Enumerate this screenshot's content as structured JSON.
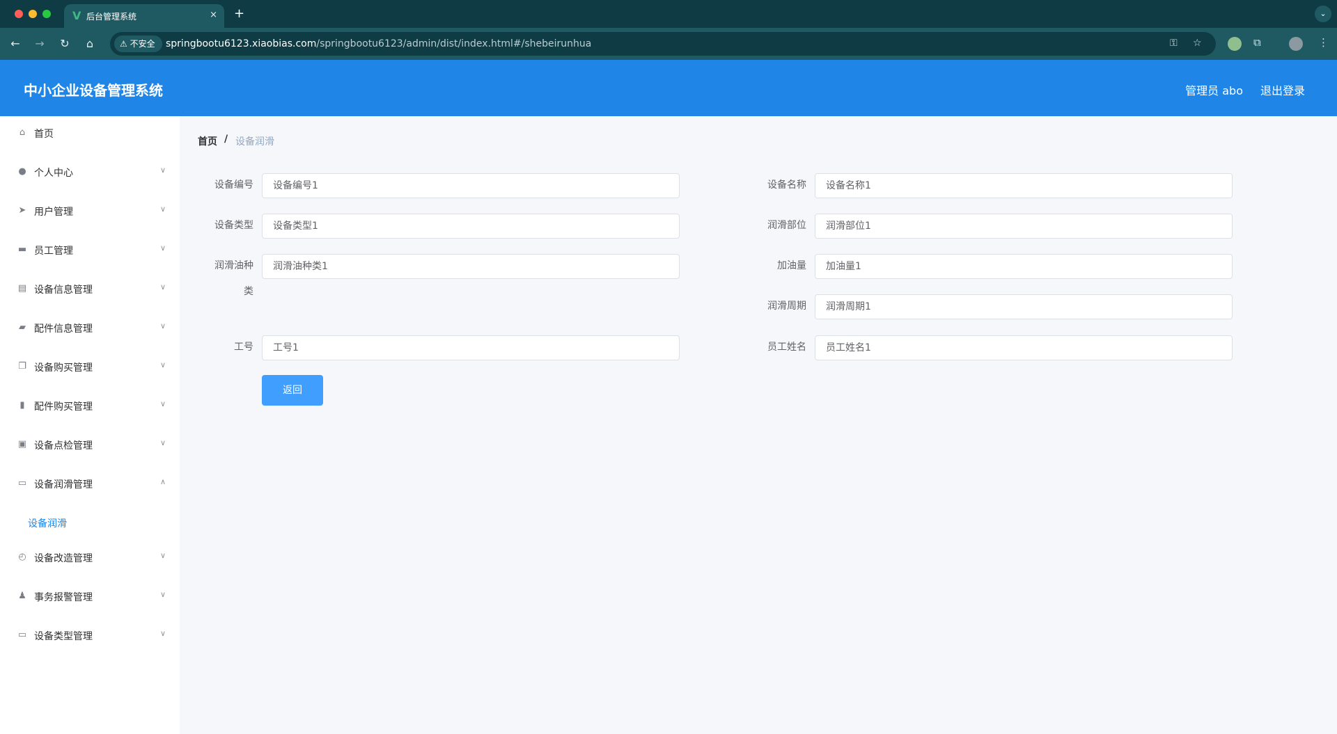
{
  "browser": {
    "tab_title": "后台管理系统",
    "tab_close": "×",
    "new_tab": "+",
    "insecure_label": "不安全",
    "url_host": "springbootu6123.xiaobias.com",
    "url_path": "/springbootu6123/admin/dist/index.html#/shebeirunhua"
  },
  "header": {
    "app_title": "中小企业设备管理系统",
    "user_label": "管理员 abo",
    "logout_label": "退出登录"
  },
  "sidebar": {
    "items": [
      {
        "label": "首页",
        "icon": "home-icon",
        "expanded": null
      },
      {
        "label": "个人中心",
        "icon": "user-icon",
        "expanded": false
      },
      {
        "label": "用户管理",
        "icon": "send-icon",
        "expanded": false
      },
      {
        "label": "员工管理",
        "icon": "monitor-icon",
        "expanded": false
      },
      {
        "label": "设备信息管理",
        "icon": "clipboard-icon",
        "expanded": false
      },
      {
        "label": "配件信息管理",
        "icon": "wallet-icon",
        "expanded": false
      },
      {
        "label": "设备购买管理",
        "icon": "copy-icon",
        "expanded": false
      },
      {
        "label": "配件购买管理",
        "icon": "bar-chart-icon",
        "expanded": false
      },
      {
        "label": "设备点检管理",
        "icon": "checklist-icon",
        "expanded": false
      },
      {
        "label": "设备润滑管理",
        "icon": "chat-icon",
        "expanded": true
      },
      {
        "label": "设备改造管理",
        "icon": "compass-icon",
        "expanded": false
      },
      {
        "label": "事务报警管理",
        "icon": "person-stamp-icon",
        "expanded": false
      },
      {
        "label": "设备类型管理",
        "icon": "id-card-icon",
        "expanded": false
      }
    ],
    "submenu_active": "设备润滑"
  },
  "breadcrumb": {
    "home": "首页",
    "separator": "/",
    "current": "设备润滑"
  },
  "form": {
    "fields": {
      "device_no": {
        "label": "设备编号",
        "value": "设备编号1"
      },
      "device_name": {
        "label": "设备名称",
        "value": "设备名称1"
      },
      "device_type": {
        "label": "设备类型",
        "value": "设备类型1"
      },
      "lube_part": {
        "label": "润滑部位",
        "value": "润滑部位1"
      },
      "oil_type": {
        "label_line1": "润滑油种",
        "label_line2": "类",
        "value": "润滑油种类1"
      },
      "oil_amount": {
        "label": "加油量",
        "value": "加油量1"
      },
      "lube_cycle": {
        "label": "润滑周期",
        "value": "润滑周期1"
      },
      "work_no": {
        "label": "工号",
        "value": "工号1"
      },
      "employee_name": {
        "label": "员工姓名",
        "value": "员工姓名1"
      }
    },
    "back_button": "返回"
  },
  "colors": {
    "header_bg": "#1f86e8",
    "accent": "#409eff",
    "browser_dark": "#0f3c44",
    "browser_toolbar": "#1f5a63"
  }
}
